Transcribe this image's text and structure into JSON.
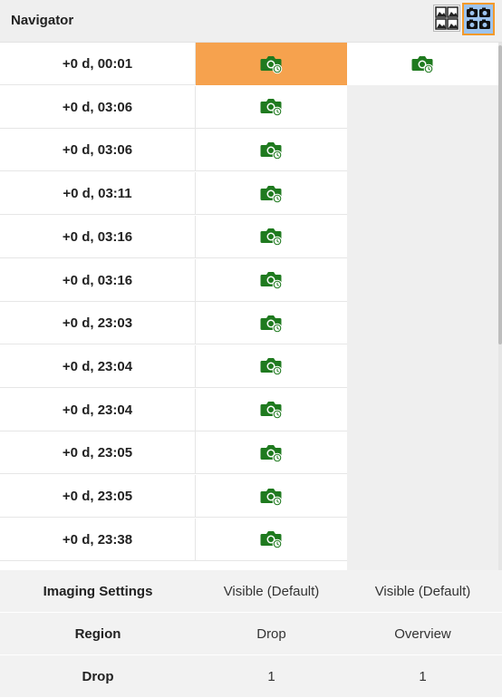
{
  "header": {
    "title": "Navigator",
    "thumbnail_view_icon": "image-grid-icon",
    "camera_view_icon": "camera-grid-icon"
  },
  "rows": [
    {
      "time": "+0 d, 00:01",
      "selected": true,
      "overview": true
    },
    {
      "time": "+0 d, 03:06"
    },
    {
      "time": "+0 d, 03:06"
    },
    {
      "time": "+0 d, 03:11"
    },
    {
      "time": "+0 d, 03:16"
    },
    {
      "time": "+0 d, 03:16"
    },
    {
      "time": "+0 d, 23:03"
    },
    {
      "time": "+0 d, 23:04"
    },
    {
      "time": "+0 d, 23:04"
    },
    {
      "time": "+0 d, 23:05"
    },
    {
      "time": "+0 d, 23:05"
    },
    {
      "time": "+0 d, 23:38"
    }
  ],
  "cell_icon": "scheduled-camera-icon",
  "footer": [
    {
      "label": "Imaging Settings",
      "col1": "Visible (Default)",
      "col2": "Visible (Default)"
    },
    {
      "label": "Region",
      "col1": "Drop",
      "col2": "Overview"
    },
    {
      "label": "Drop",
      "col1": "1",
      "col2": "1"
    }
  ],
  "colors": {
    "selected_cell": "#f6a24e",
    "camera_icon": "#1f7a1f",
    "active_toggle_border": "#f39a2b",
    "active_toggle_bg": "#9cc3ee"
  }
}
